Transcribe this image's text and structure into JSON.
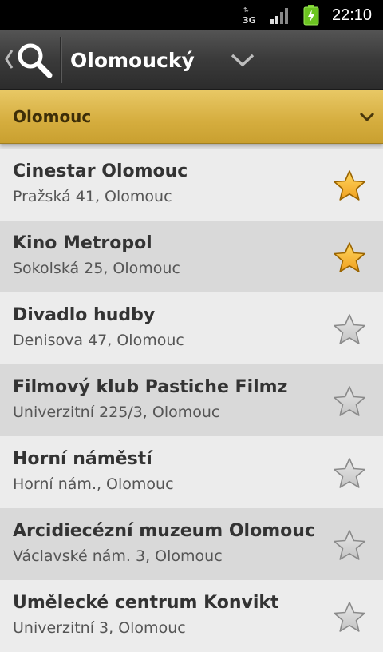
{
  "status_bar": {
    "network": "3G",
    "time": "22:10"
  },
  "action_bar": {
    "title": "Olomoucký",
    "icons": {
      "back": "back-chevron-icon",
      "search": "search-icon",
      "dropdown": "chevron-down-icon"
    }
  },
  "city_selector": {
    "label": "Olomouc",
    "icon": "chevron-down-icon"
  },
  "colors": {
    "accent_gold": "#d5ad3e",
    "star_filled": "#f0a020",
    "star_empty": "#c4c4c4"
  },
  "venues": [
    {
      "name": "Cinestar Olomouc",
      "address": "Pražská 41, Olomouc",
      "favorite": true
    },
    {
      "name": "Kino Metropol",
      "address": "Sokolská 25, Olomouc",
      "favorite": true
    },
    {
      "name": "Divadlo hudby",
      "address": "Denisova 47, Olomouc",
      "favorite": false
    },
    {
      "name": "Filmový klub Pastiche Filmz",
      "address": "Univerzitní 225/3, Olomouc",
      "favorite": false
    },
    {
      "name": "Horní náměstí",
      "address": "Horní nám., Olomouc",
      "favorite": false
    },
    {
      "name": "Arcidiecézní muzeum Olomouc",
      "address": "Václavské nám. 3, Olomouc",
      "favorite": false
    },
    {
      "name": "Umělecké centrum Konvikt",
      "address": "Univerzitní 3, Olomouc",
      "favorite": false
    }
  ]
}
